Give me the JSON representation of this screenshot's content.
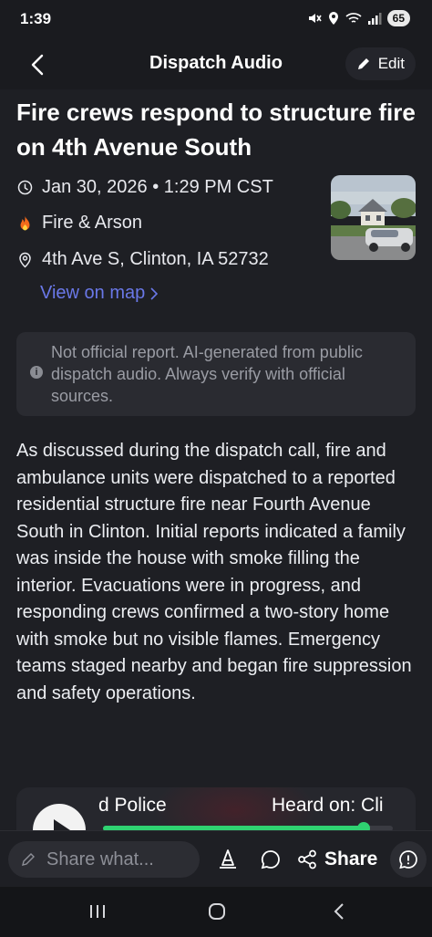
{
  "status_bar": {
    "time": "1:39",
    "battery": "65",
    "icons": [
      "mute-icon",
      "location-icon",
      "wifi-icon",
      "signal-icon"
    ]
  },
  "header": {
    "title": "Dispatch Audio",
    "edit_label": "Edit",
    "icons": {
      "back": "chevron-left-icon",
      "edit": "pencil-icon"
    }
  },
  "article": {
    "title": "Fire crews respond to structure fire on 4th Avenue South",
    "datetime": "Jan 30, 2026 • 1:29 PM CST",
    "category": "Fire & Arson",
    "address": "4th Ave S, Clinton, IA 52732",
    "map_link": "View on map",
    "notice": "Not official report. AI-generated from public dispatch audio. Always verify with official sources.",
    "body": "As discussed during the dispatch call, fire and ambulance units were dispatched to a reported residential structure fire near Fourth Avenue South in Clinton. Initial reports indicated a family was inside the house with smoke filling the interior. Evacuations were in progress, and responding crews confirmed a two-story home with smoke but no visible flames. Emergency teams staged nearby and began fire suppression and safety operations."
  },
  "audio": {
    "label": "d Police",
    "heard_on": "Heard on: Cli",
    "progress": 0.9
  },
  "bottom_bar": {
    "share_placeholder": "Share what...",
    "share_label": "Share"
  },
  "colors": {
    "background": "#1e1f24",
    "link": "#6a78e8",
    "progress": "#2fd271",
    "fire": "#f26a1b"
  }
}
